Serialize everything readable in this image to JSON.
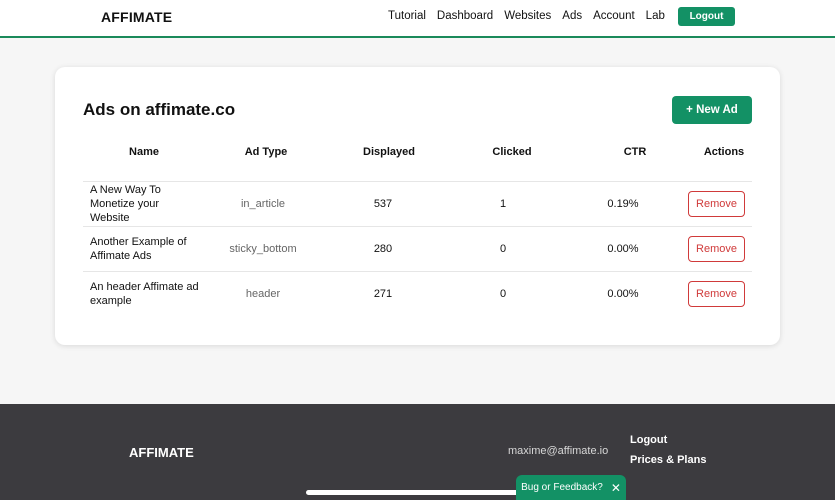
{
  "header": {
    "brand": "AFFIMATE",
    "nav": [
      "Tutorial",
      "Dashboard",
      "Websites",
      "Ads",
      "Account",
      "Lab"
    ],
    "logout_label": "Logout"
  },
  "main": {
    "title": "Ads on affimate.co",
    "new_ad_label": "+ New Ad",
    "columns": [
      "Name",
      "Ad Type",
      "Displayed",
      "Clicked",
      "CTR",
      "Actions"
    ],
    "rows": [
      {
        "name": "A New Way To Monetize your Website",
        "type": "in_article",
        "displayed": "537",
        "clicked": "1",
        "ctr": "0.19%",
        "action": "Remove"
      },
      {
        "name": "Another Example of Affimate Ads",
        "type": "sticky_bottom",
        "displayed": "280",
        "clicked": "0",
        "ctr": "0.00%",
        "action": "Remove"
      },
      {
        "name": "An header Affimate ad example",
        "type": "header",
        "displayed": "271",
        "clicked": "0",
        "ctr": "0.00%",
        "action": "Remove"
      }
    ]
  },
  "footer": {
    "brand": "AFFIMATE",
    "email": "maxime@affimate.io",
    "links": [
      "Logout",
      "Prices & Plans"
    ]
  },
  "feedback": {
    "label": "Bug or Feedback?",
    "close_icon": "close-icon"
  },
  "colors": {
    "accent": "#139165",
    "danger": "#d03a3a",
    "footer_bg": "#3c3b3f"
  }
}
